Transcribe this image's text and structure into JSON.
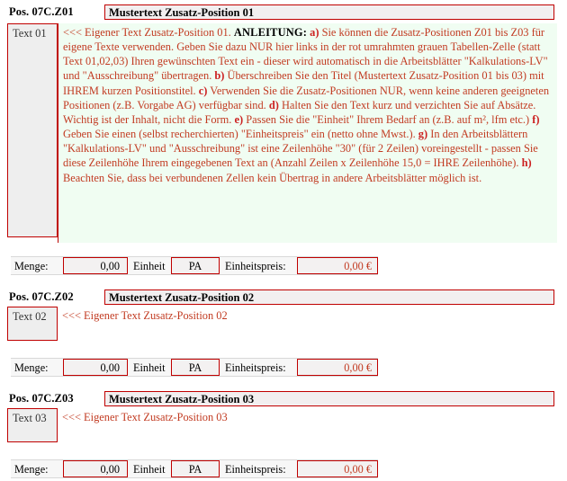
{
  "document": {
    "type": "spreadsheet-form",
    "accent_red": "#c00000",
    "text_red": "#c23b22",
    "block_background_green": "#f0fdf2",
    "cell_background_gray": "#eeeeee",
    "title_background": "#f2eff0"
  },
  "positions": [
    {
      "pos_label": "Pos. 07C.Z01",
      "title": "Mustertext Zusatz-Position 01",
      "text_cell_label": "Text 01",
      "body_prefix": "<<< Eigener Text Zusatz-Position 01. ",
      "body_heading": "ANLEITUNG:",
      "body_rest": " a) Sie können die Zusatz-Positionen Z01 bis Z03 für eigene Texte verwenden. Geben Sie dazu NUR hier links in der rot umrahmten grauen Tabellen-Zelle (statt Text 01,02,03) Ihren gewünschten Text ein - dieser wird automatisch in die Arbeitsblätter \"Kalkulations-LV\" und \"Ausschreibung\" übertragen. b) Überschreiben Sie den Titel (Mustertext Zusatz-Position 01 bis 03) mit IHREM kurzen Positionstitel. c) Verwenden Sie die Zusatz-Positionen NUR, wenn keine anderen geeigneten Positionen (z.B. Vorgabe AG) verfügbar sind. d) Halten Sie den Text kurz und verzichten Sie auf Absätze. Wichtig ist der Inhalt, nicht die Form. e) Passen Sie die \"Einheit\" Ihrem Bedarf an (z.B. auf m², lfm etc.) f) Geben Sie einen (selbst recherchierten) \"Einheitspreis\" ein (netto ohne Mwst.). g) In den Arbeitsblättern \"Kalkulations-LV\" und \"Ausschreibung\" ist eine Zeilenhöhe \"30\" (für 2 Zeilen) voreingestellt - passen Sie diese Zeilenhöhe Ihrem eingegebenen Text an (Anzahl Zeilen x Zeilenhöhe 15,0 = IHRE Zeilenhöhe). h) Beachten Sie, dass bei verbundenen Zellen kein Übertrag in andere Arbeitsblätter möglich ist.",
      "menge": {
        "menge_label": "Menge:",
        "menge_value": "0,00",
        "einheit_label": "Einheit",
        "einheit_value": "PA",
        "einheitspreis_label": "Einheitspreis:",
        "einheitspreis_value": "0,00 €"
      }
    },
    {
      "pos_label": "Pos. 07C.Z02",
      "title": "Mustertext Zusatz-Position 02",
      "text_cell_label": "Text 02",
      "body_text": "<<< Eigener Text Zusatz-Position 02",
      "menge": {
        "menge_label": "Menge:",
        "menge_value": "0,00",
        "einheit_label": "Einheit",
        "einheit_value": "PA",
        "einheitspreis_label": "Einheitspreis:",
        "einheitspreis_value": "0,00 €"
      }
    },
    {
      "pos_label": "Pos. 07C.Z03",
      "title": "Mustertext Zusatz-Position 03",
      "text_cell_label": "Text 03",
      "body_text": "<<< Eigener Text Zusatz-Position 03",
      "menge": {
        "menge_label": "Menge:",
        "menge_value": "0,00",
        "einheit_label": "Einheit",
        "einheit_value": "PA",
        "einheitspreis_label": "Einheitspreis:",
        "einheitspreis_value": "0,00 €"
      }
    }
  ]
}
